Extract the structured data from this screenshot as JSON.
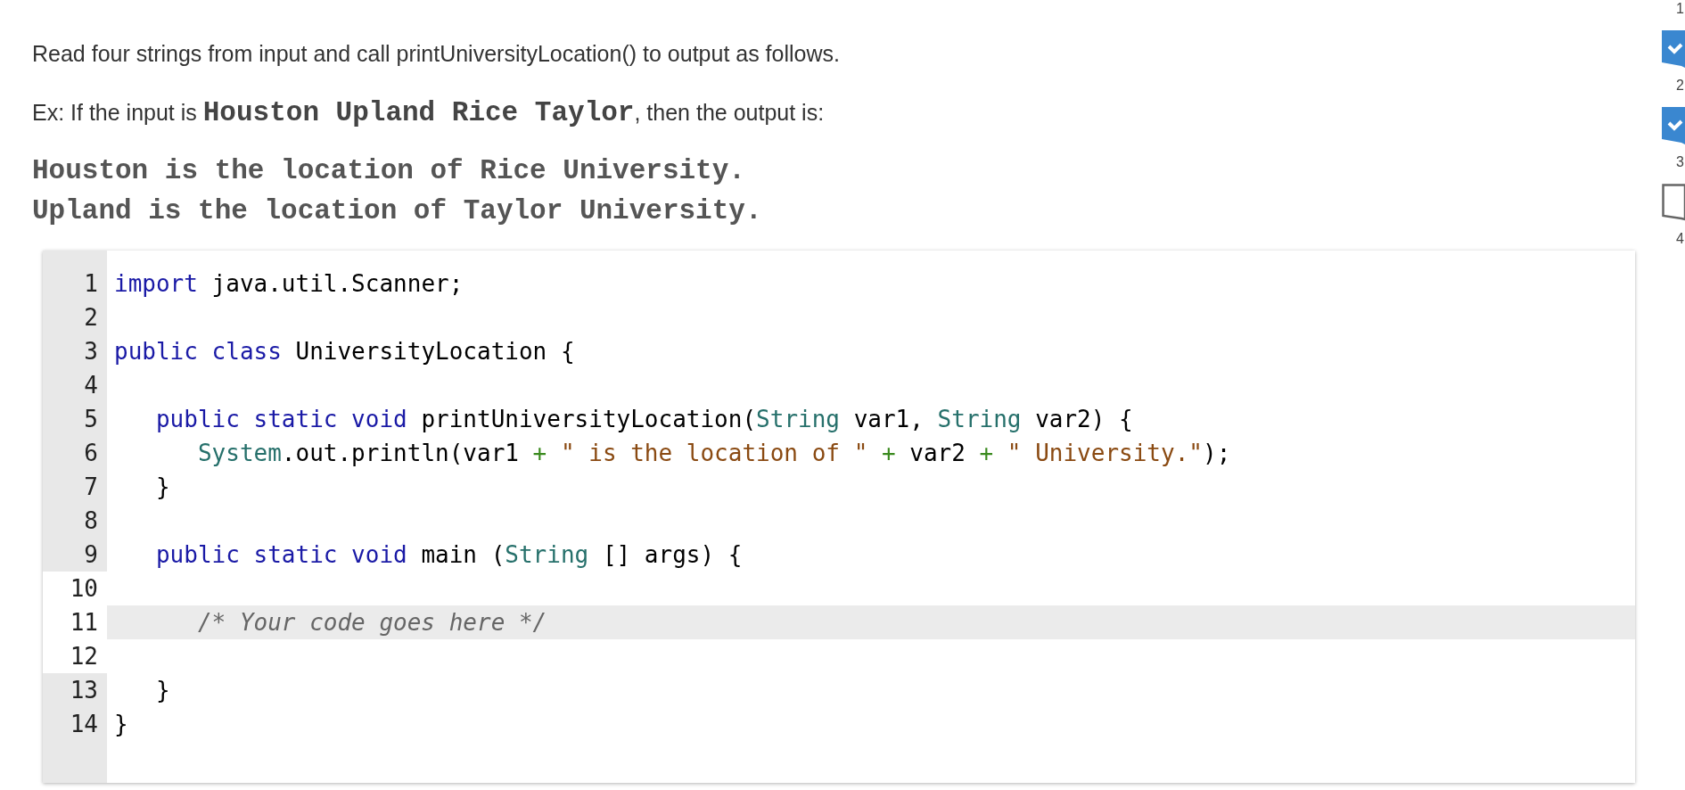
{
  "instructions": "Read four strings from input and call printUniversityLocation() to output as follows.",
  "example": [
    {
      "kind": "plain",
      "text": "Ex: If the input is "
    },
    {
      "kind": "code",
      "text": "Houston Upland Rice Taylor"
    },
    {
      "kind": "plain",
      "text": ", then the output is:"
    }
  ],
  "expected_output": [
    "Houston is the location of Rice University.",
    "Upland is the location of Taylor University."
  ],
  "editor": {
    "lines": [
      {
        "number": "1",
        "editable": false,
        "current": false,
        "tokens": [
          {
            "kind": "keyword",
            "text": "import"
          },
          {
            "kind": "plain",
            "text": " java.util.Scanner;"
          }
        ]
      },
      {
        "number": "2",
        "editable": false,
        "current": false
      },
      {
        "number": "3",
        "editable": false,
        "current": false,
        "tokens": [
          {
            "kind": "keyword",
            "text": "public class"
          },
          {
            "kind": "plain",
            "text": " UniversityLocation {"
          }
        ]
      },
      {
        "number": "4",
        "editable": false,
        "current": false
      },
      {
        "number": "5",
        "editable": false,
        "current": false,
        "tokens": [
          {
            "kind": "keyword",
            "text": "   public static void"
          },
          {
            "kind": "plain",
            "text": " printUniversityLocation("
          },
          {
            "kind": "type",
            "text": "String"
          },
          {
            "kind": "plain",
            "text": " var1, "
          },
          {
            "kind": "type",
            "text": "String"
          },
          {
            "kind": "plain",
            "text": " var2) {"
          }
        ]
      },
      {
        "number": "6",
        "editable": false,
        "current": false,
        "tokens": [
          {
            "kind": "type",
            "text": "      System"
          },
          {
            "kind": "plain",
            "text": ".out.println(var1 "
          },
          {
            "kind": "operator",
            "text": "+"
          },
          {
            "kind": "string",
            "text": " \" is the location of \""
          },
          {
            "kind": "operator",
            "text": " +"
          },
          {
            "kind": "plain",
            "text": " var2 "
          },
          {
            "kind": "operator",
            "text": "+"
          },
          {
            "kind": "string",
            "text": " \" University.\""
          },
          {
            "kind": "plain",
            "text": ");"
          }
        ]
      },
      {
        "number": "7",
        "editable": false,
        "current": false,
        "tokens": [
          {
            "kind": "plain",
            "text": "   }"
          }
        ]
      },
      {
        "number": "8",
        "editable": false,
        "current": false
      },
      {
        "number": "9",
        "editable": false,
        "current": false,
        "tokens": [
          {
            "kind": "keyword",
            "text": "   public static void"
          },
          {
            "kind": "plain",
            "text": " main ("
          },
          {
            "kind": "type",
            "text": "String"
          },
          {
            "kind": "plain",
            "text": " [] args) {"
          }
        ]
      },
      {
        "number": "10",
        "editable": true,
        "current": false
      },
      {
        "number": "11",
        "editable": true,
        "current": true,
        "tokens": [
          {
            "kind": "comment",
            "text": "      /* Your code goes here */"
          }
        ]
      },
      {
        "number": "12",
        "editable": true,
        "current": false
      },
      {
        "number": "13",
        "editable": false,
        "current": false,
        "tokens": [
          {
            "kind": "plain",
            "text": "   }"
          }
        ]
      },
      {
        "number": "14",
        "editable": false,
        "current": false,
        "tokens": [
          {
            "kind": "plain",
            "text": "}"
          }
        ]
      }
    ]
  },
  "steps": [
    {
      "label": "1"
    },
    {
      "checked": true,
      "label": "2"
    },
    {
      "checked": true,
      "label": "3"
    },
    {
      "checked": false,
      "label": "4"
    }
  ]
}
